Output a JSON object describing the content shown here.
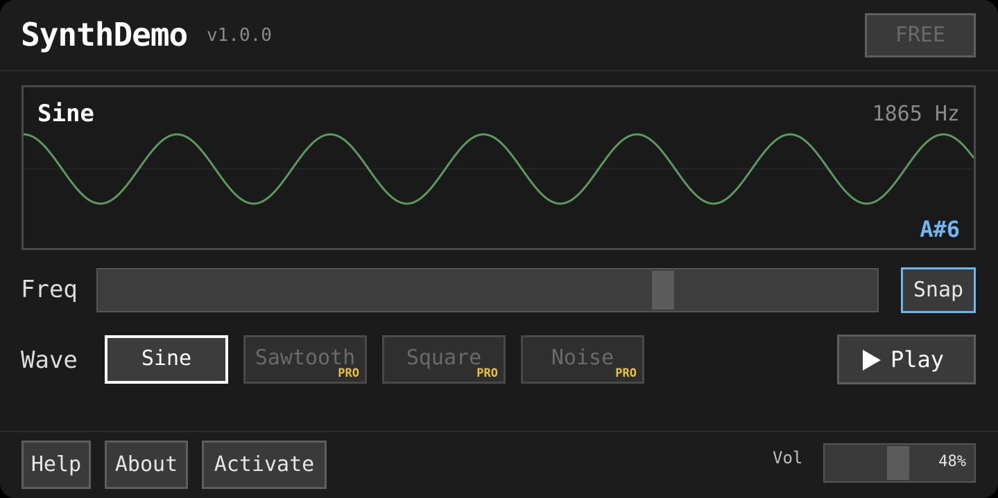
{
  "header": {
    "title": "SynthDemo",
    "version": "v1.0.0",
    "license_badge": "FREE"
  },
  "scope": {
    "wave_name": "Sine",
    "frequency": "1865 Hz",
    "note": "A#6",
    "wave_color": "#5a9a5c",
    "note_color": "#6fb6ee"
  },
  "controls": {
    "freq_label": "Freq",
    "freq_slider_value": 0.73,
    "snap_label": "Snap",
    "snap_accent": "#6fb6ee",
    "wave_label": "Wave",
    "waves": [
      {
        "label": "Sine",
        "selected": true,
        "pro": false
      },
      {
        "label": "Sawtooth",
        "selected": false,
        "pro": true
      },
      {
        "label": "Square",
        "selected": false,
        "pro": true
      },
      {
        "label": "Noise",
        "selected": false,
        "pro": true
      }
    ],
    "pro_tag": "PRO",
    "pro_color": "#e8c23a",
    "play_label": "Play",
    "play_icon": "play-icon"
  },
  "footer": {
    "help_label": "Help",
    "about_label": "About",
    "activate_label": "Activate",
    "vol_label": "Vol",
    "vol_value_text": "48%",
    "vol_level": 0.48
  }
}
